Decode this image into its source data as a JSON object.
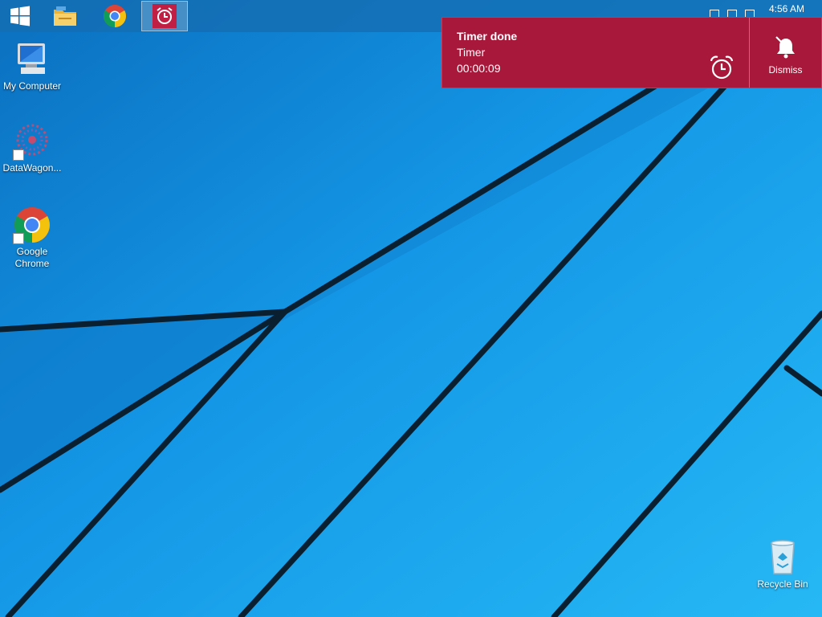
{
  "taskbar": {
    "items": [
      {
        "name": "Start",
        "icon": "windows-logo-icon"
      },
      {
        "name": "File Explorer",
        "icon": "folder-icon"
      },
      {
        "name": "Google Chrome",
        "icon": "chrome-icon"
      },
      {
        "name": "Alarms & Clock",
        "icon": "alarm-clock-icon",
        "active": true
      }
    ],
    "clock": "4:56 AM"
  },
  "desktop": {
    "icons": [
      {
        "label": "My Computer",
        "icon": "computer-icon"
      },
      {
        "label": "DataWagon...",
        "icon": "datawagon-icon",
        "shortcut": true
      },
      {
        "label": "Google Chrome",
        "icon": "chrome-icon",
        "shortcut": true
      },
      {
        "label": "Recycle Bin",
        "icon": "recycle-bin-icon"
      }
    ]
  },
  "notification": {
    "title": "Timer done",
    "subtitle": "Timer",
    "time": "00:00:09",
    "dismiss_label": "Dismiss",
    "background": "#a8183a",
    "icon": "alarm-clock-icon",
    "dismiss_icon": "bell-off-icon"
  },
  "colors": {
    "wallpaper": "#1aa3ec",
    "taskbar": "#146eb4",
    "accent": "#a8183a"
  }
}
